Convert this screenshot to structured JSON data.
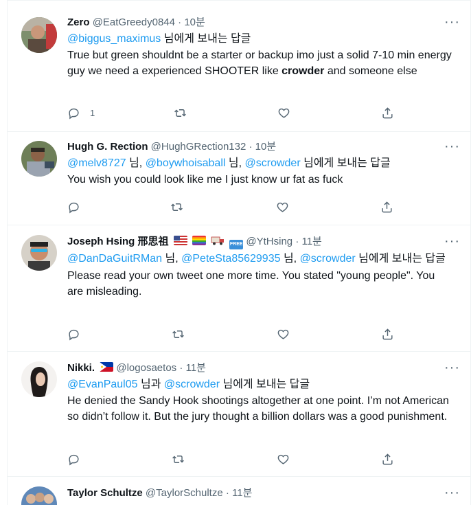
{
  "tweets": [
    {
      "name": "Zero",
      "handle": "@EatGreedy0844",
      "dot": "·",
      "time": "10분",
      "reply_mentions": [
        "@biggus_maximus"
      ],
      "reply_tail": "님에게 보내는 답글",
      "text_before": "True but green shouldnt be a starter or backup imo just a solid 7-10 min energy guy we need a experienced SHOOTER  like ",
      "text_bold": "crowder",
      "text_after": " and someone else",
      "reply_count": "1"
    },
    {
      "name": "Hugh G. Rection",
      "handle": "@HughGRection132",
      "dot": "·",
      "time": "10분",
      "m1": "@melv8727",
      "sep1": " 님, ",
      "m2": "@boywhoisaball",
      "sep2": " 님, ",
      "m3": "@scrowder",
      "reply_tail": " 님에게 보내는 답글",
      "text": "You wish you could look like me I just know ur fat as fuck"
    },
    {
      "name": "Joseph Hsing 邢思祖",
      "handle": "@YtHsing",
      "dot": "·",
      "time": "11분",
      "m1": "@DanDaGuitRMan",
      "sep1": " 님, ",
      "m2": "@PeteSta85629935",
      "sep2": " 님, ",
      "m3": "@scrowder",
      "reply_tail": " 님에게 보내는 답글",
      "text": "Please read your own tweet one more time. You stated \"young people\". You are misleading.",
      "emoji_free": "FREE"
    },
    {
      "name": "Nikki.",
      "handle": "@logosaetos",
      "dot": "·",
      "time": "11분",
      "m1": "@EvanPaul05",
      "sep1": " 님과 ",
      "m2": "@scrowder",
      "reply_tail": " 님에게 보내는 답글",
      "text": "He denied the Sandy Hook shootings altogether at one point. I’m not American so didn’t follow it. But the jury thought a billion dollars was a good punishment."
    },
    {
      "name": "Taylor Schultze",
      "handle": "@TaylorSchultze",
      "dot": "·",
      "time": "11분"
    }
  ],
  "icons": {
    "reply": "reply-icon",
    "retweet": "retweet-icon",
    "like": "heart-icon",
    "share": "share-icon",
    "more": "more-icon"
  },
  "colors": {
    "mention": "#1d9bf0",
    "secondary": "#536471",
    "divider": "#eff3f4"
  }
}
